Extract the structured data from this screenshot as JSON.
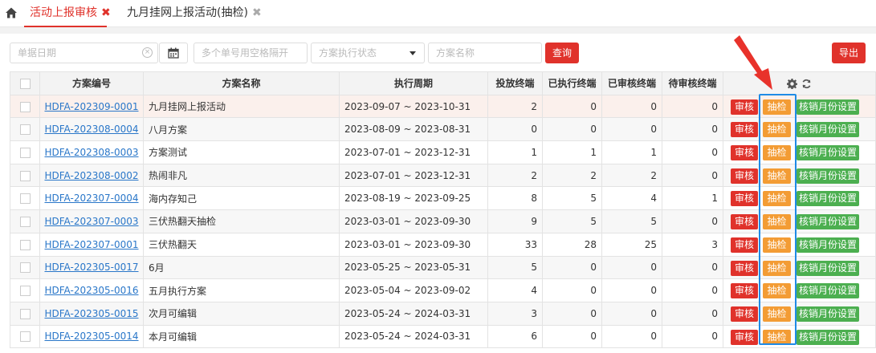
{
  "tabs": [
    {
      "label": "活动上报审核",
      "close": "✖"
    },
    {
      "label": "九月挂网上报活动(抽检)",
      "close": "✖"
    }
  ],
  "filters": {
    "date_placeholder": "单据日期",
    "codes_placeholder": "多个单号用空格隔开",
    "status_placeholder": "方案执行状态",
    "name_placeholder": "方案名称",
    "query_label": "查询",
    "export_label": "导出"
  },
  "table": {
    "headers": [
      "方案编号",
      "方案名称",
      "执行周期",
      "投放终端",
      "已执行终端",
      "已审核终端",
      "待审核终端"
    ],
    "actions": {
      "review": "审核",
      "check": "抽检",
      "monthly": "核销月份设置"
    },
    "rows": [
      {
        "code": "HDFA-202309-0001",
        "name": "九月挂网上报活动",
        "period": "2023-09-07 ~ 2023-10-31",
        "placed": "2",
        "executed": "0",
        "audited": "0",
        "pending": "0"
      },
      {
        "code": "HDFA-202308-0004",
        "name": "八月方案",
        "period": "2023-08-09 ~ 2023-08-31",
        "placed": "0",
        "executed": "0",
        "audited": "0",
        "pending": "0"
      },
      {
        "code": "HDFA-202308-0003",
        "name": "方案测试",
        "period": "2023-07-01 ~ 2023-12-31",
        "placed": "1",
        "executed": "1",
        "audited": "1",
        "pending": "0"
      },
      {
        "code": "HDFA-202308-0002",
        "name": "热闹非凡",
        "period": "2023-07-01 ~ 2023-12-31",
        "placed": "2",
        "executed": "2",
        "audited": "2",
        "pending": "0"
      },
      {
        "code": "HDFA-202307-0004",
        "name": "海内存知己",
        "period": "2023-08-19 ~ 2023-09-25",
        "placed": "8",
        "executed": "5",
        "audited": "4",
        "pending": "1"
      },
      {
        "code": "HDFA-202307-0003",
        "name": "三伏热翻天抽检",
        "period": "2023-03-01 ~ 2023-09-30",
        "placed": "9",
        "executed": "5",
        "audited": "5",
        "pending": "0"
      },
      {
        "code": "HDFA-202307-0001",
        "name": "三伏热翻天",
        "period": "2023-03-01 ~ 2023-09-30",
        "placed": "33",
        "executed": "28",
        "audited": "25",
        "pending": "3"
      },
      {
        "code": "HDFA-202305-0017",
        "name": "6月",
        "period": "2023-05-25 ~ 2023-05-31",
        "placed": "5",
        "executed": "0",
        "audited": "0",
        "pending": "0"
      },
      {
        "code": "HDFA-202305-0016",
        "name": "五月执行方案",
        "period": "2023-05-04 ~ 2023-09-02",
        "placed": "4",
        "executed": "0",
        "audited": "0",
        "pending": "0"
      },
      {
        "code": "HDFA-202305-0015",
        "name": "次月可编辑",
        "period": "2023-05-24 ~ 2024-03-31",
        "placed": "3",
        "executed": "0",
        "audited": "0",
        "pending": "0"
      },
      {
        "code": "HDFA-202305-0014",
        "name": "本月可编辑",
        "period": "2023-05-24 ~ 2024-03-31",
        "placed": "6",
        "executed": "0",
        "audited": "0",
        "pending": "0"
      }
    ]
  },
  "colors": {
    "brand_red": "#e0322b",
    "check_orange": "#f39c34",
    "monthly_green": "#4caf50",
    "link_blue": "#2a77c9",
    "annotation_blue": "#1f8be6",
    "annotation_arrow": "#e8322b"
  },
  "icons": {
    "home": "home-icon",
    "calendar": "calendar-icon",
    "gear": "gear-icon",
    "refresh": "refresh-icon",
    "clear": "clear-icon",
    "dropdown": "chevron-down-icon"
  }
}
